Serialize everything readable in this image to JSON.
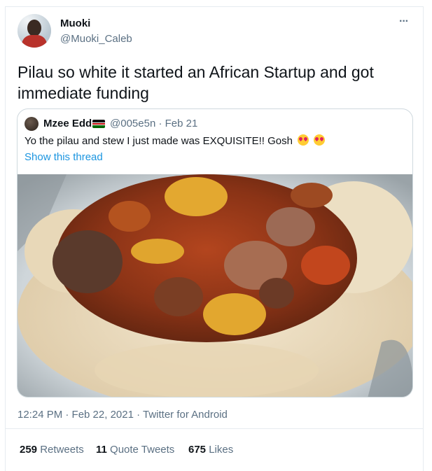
{
  "author": {
    "name": "Muoki",
    "handle": "@Muoki_Caleb",
    "more_icon": "more-icon"
  },
  "tweet": {
    "text": "Pilau so white it started an African Startup and got immediate funding",
    "timestamp": "12:24 PM · Feb 22, 2021 · Twitter for Android"
  },
  "quote": {
    "name": "Mzee Edd",
    "flag": "kenya-flag-icon",
    "handle": "@005e5n · Feb 21",
    "text": "Yo the pilau and stew I just made was EXQUISITE!! Gosh",
    "emojis": [
      "heart-eyes-emoji",
      "heart-eyes-emoji"
    ],
    "show_thread": "Show this thread"
  },
  "stats": {
    "retweets": {
      "count": "259",
      "label": "Retweets"
    },
    "quotes": {
      "count": "11",
      "label": "Quote Tweets"
    },
    "likes": {
      "count": "675",
      "label": "Likes"
    }
  },
  "colors": {
    "text": "#0f1419",
    "secondary": "#5b7083",
    "link": "#1b95e0",
    "border": "#cfd9de"
  }
}
